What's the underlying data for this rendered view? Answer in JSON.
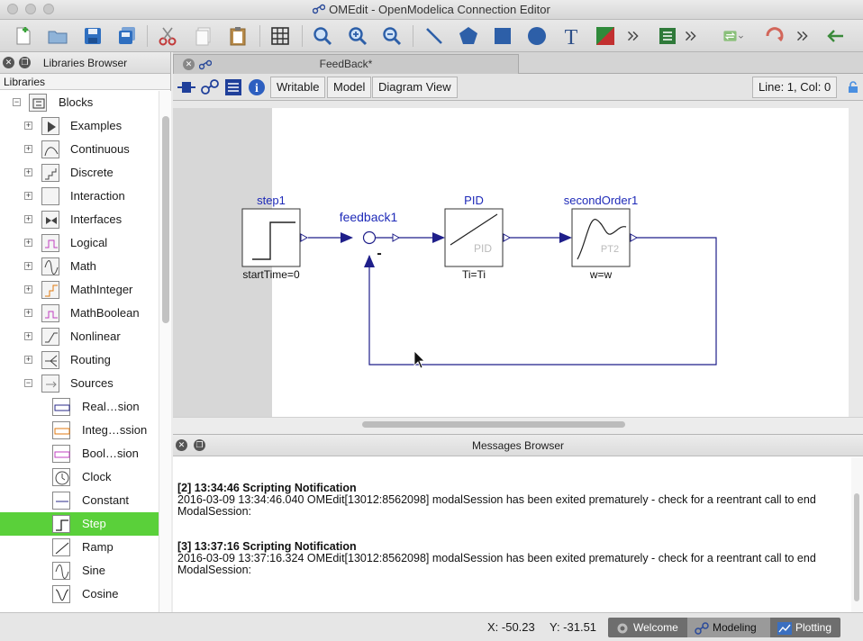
{
  "window": {
    "title": "OMEdit - OpenModelica Connection Editor"
  },
  "toolbar": {
    "icons": [
      "new-file-icon",
      "open-folder-icon",
      "save-icon",
      "save-all-icon",
      "cut-icon",
      "copy-icon",
      "paste-icon",
      "grid-icon",
      "zoom-reset-icon",
      "zoom-in-icon",
      "zoom-out-icon",
      "line-icon",
      "polygon-icon",
      "rectangle-icon",
      "ellipse-icon",
      "text-icon",
      "bitmap-icon",
      "overflow-icon",
      "check-icon",
      "overflow-icon",
      "simulate-icon",
      "instantiate-icon",
      "overflow-icon",
      "back-icon"
    ]
  },
  "libraries": {
    "title": "Libraries Browser",
    "column_header": "Libraries",
    "root": "Blocks",
    "items": [
      {
        "label": "Examples",
        "icon": "play-icon"
      },
      {
        "label": "Continuous",
        "icon": "curve-icon"
      },
      {
        "label": "Discrete",
        "icon": "step-curve-icon"
      },
      {
        "label": "Interaction",
        "icon": "blank-icon"
      },
      {
        "label": "Interfaces",
        "icon": "interface-icon"
      },
      {
        "label": "Logical",
        "icon": "logical-icon"
      },
      {
        "label": "Math",
        "icon": "sine-icon"
      },
      {
        "label": "MathInteger",
        "icon": "integer-icon"
      },
      {
        "label": "MathBoolean",
        "icon": "boolean-icon"
      },
      {
        "label": "Nonlinear",
        "icon": "limiter-icon"
      },
      {
        "label": "Routing",
        "icon": "routing-icon"
      },
      {
        "label": "Sources",
        "icon": "source-icon"
      }
    ],
    "sub_items": [
      {
        "label": "Real…sion",
        "icon": "real-expression-icon"
      },
      {
        "label": "Integ…ssion",
        "icon": "integer-expression-icon"
      },
      {
        "label": "Bool…sion",
        "icon": "boolean-expression-icon"
      },
      {
        "label": "Clock",
        "icon": "clock-icon"
      },
      {
        "label": "Constant",
        "icon": "constant-icon"
      },
      {
        "label": "Step",
        "icon": "step-icon",
        "selected": true
      },
      {
        "label": "Ramp",
        "icon": "ramp-icon"
      },
      {
        "label": "Sine",
        "icon": "sine-icon"
      },
      {
        "label": "Cosine",
        "icon": "cosine-icon"
      }
    ]
  },
  "editor": {
    "tab_label": "FeedBack*",
    "modes": [
      "Writable",
      "Model",
      "Diagram View"
    ],
    "cursor_position": "Line: 1, Col: 0"
  },
  "diagram": {
    "components": [
      {
        "name": "step1",
        "param": "startTime=0"
      },
      {
        "name": "feedback1",
        "sign": "-"
      },
      {
        "name": "PID",
        "param": "Ti=Ti",
        "inner_label": "PID"
      },
      {
        "name": "secondOrder1",
        "param": "w=w",
        "inner_label": "PT2"
      }
    ],
    "line_color": "#1f1f8a",
    "label_color": "#1e2ab8"
  },
  "messages": {
    "title": "Messages Browser",
    "entries": [
      {
        "header": "[2] 13:34:46 Scripting Notification",
        "line1": "2016-03-09 13:34:46.040 OMEdit[13012:8562098] modalSession has been exited prematurely - check for a reentrant call to end",
        "line2": "ModalSession:"
      },
      {
        "header": "[3] 13:37:16 Scripting Notification",
        "line1": "2016-03-09 13:37:16.324 OMEdit[13012:8562098] modalSession has been exited prematurely - check for a reentrant call to end",
        "line2": "ModalSession:"
      }
    ]
  },
  "status": {
    "x": "X: -50.23",
    "y": "Y: -31.51",
    "perspectives": [
      {
        "label": "Welcome",
        "icon": "welcome-icon"
      },
      {
        "label": "Modeling",
        "icon": "modeling-icon",
        "active": true
      },
      {
        "label": "Plotting",
        "icon": "plotting-icon"
      }
    ]
  },
  "colors": {
    "selection": "#5ad03a",
    "accent": "#1f3f9a"
  }
}
